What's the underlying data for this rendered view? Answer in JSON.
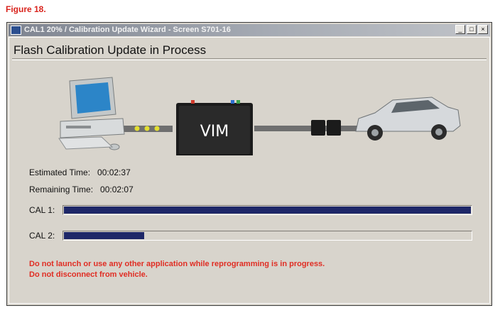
{
  "figure_label": "Figure 18.",
  "window": {
    "title": "CAL1 20% / Calibration Update Wizard - Screen S701-16",
    "icon_text": "",
    "buttons": {
      "minimize": "_",
      "maximize": "□",
      "close": "×"
    }
  },
  "heading": "Flash Calibration Update in Process",
  "diagram": {
    "device_label": "VIM"
  },
  "times": {
    "estimated_label": "Estimated Time:",
    "estimated_value": "00:02:37",
    "remaining_label": "Remaining Time:",
    "remaining_value": "00:02:07"
  },
  "calibrations": [
    {
      "label": "CAL 1:",
      "progress_percent": 100
    },
    {
      "label": "CAL 2:",
      "progress_percent": 20
    }
  ],
  "warnings": [
    "Do not launch or use any other application while reprogramming is in progress.",
    "Do not disconnect from vehicle."
  ],
  "colors": {
    "progress_fill": "#1e2768",
    "warning_text": "#e02d23",
    "figure_label": "#d9231c"
  }
}
